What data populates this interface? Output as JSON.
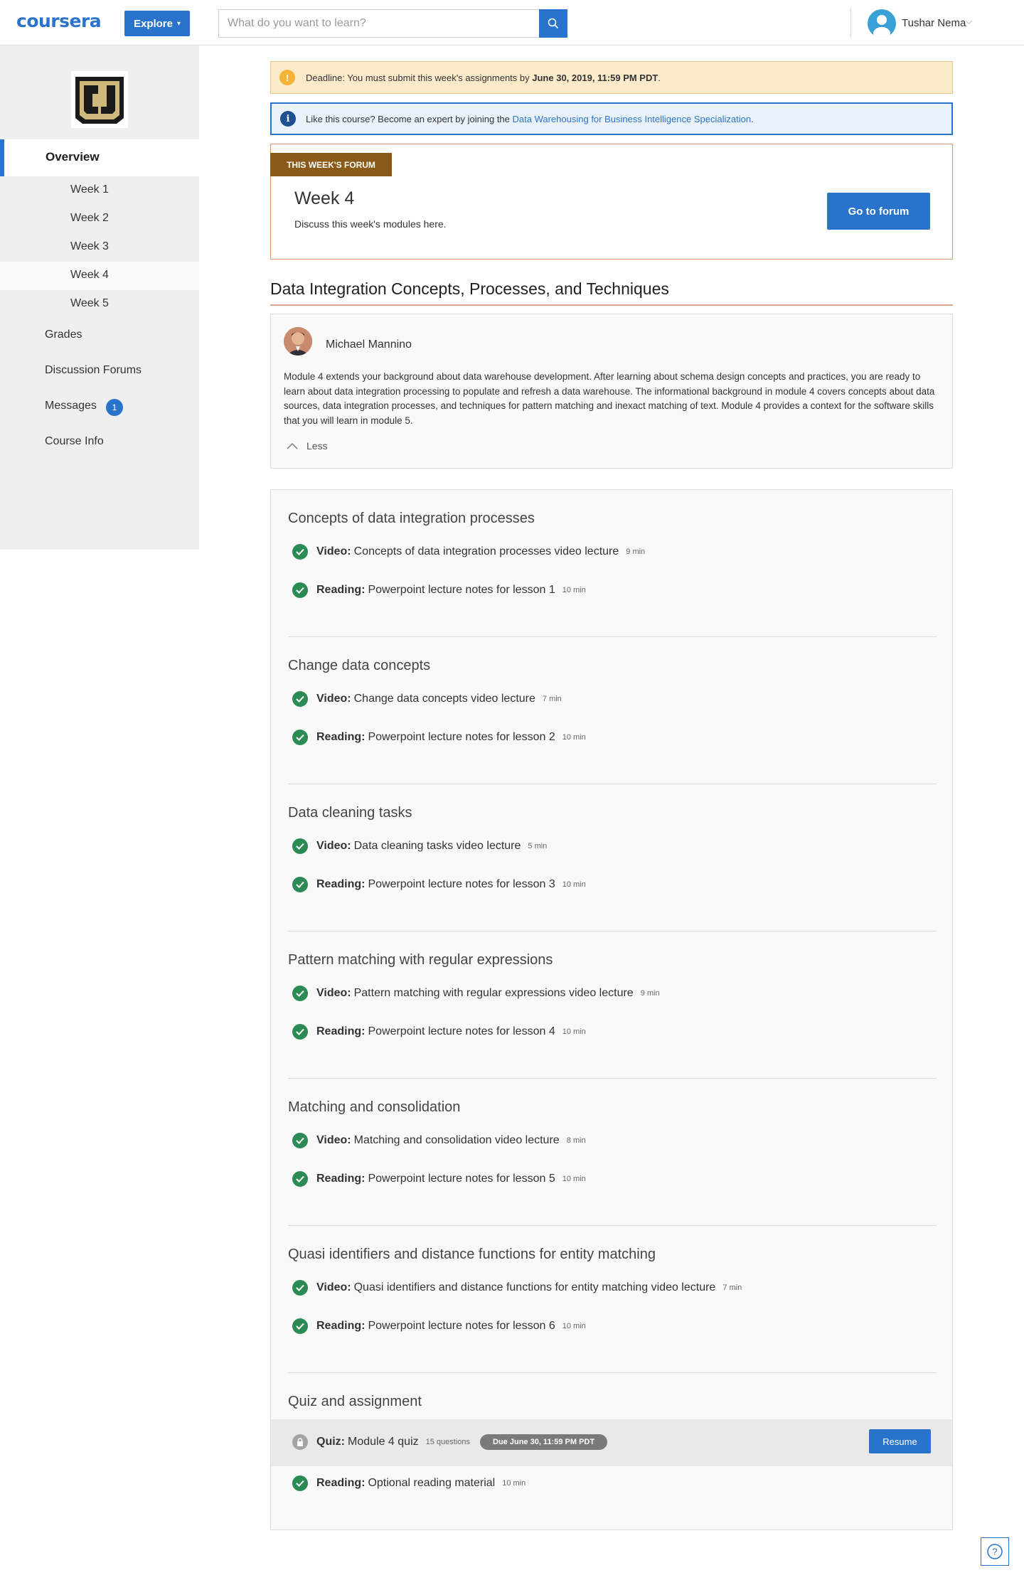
{
  "header": {
    "logo": "coursera",
    "explore_label": "Explore",
    "search_placeholder": "What do you want to learn?",
    "user_name": "Tushar Nema"
  },
  "sidebar": {
    "overview": "Overview",
    "weeks": [
      "Week 1",
      "Week 2",
      "Week 3",
      "Week 4",
      "Week 5"
    ],
    "grades": "Grades",
    "forums": "Discussion Forums",
    "messages": "Messages",
    "messages_count": "1",
    "course_info": "Course Info"
  },
  "deadline": {
    "prefix": "Deadline: You must submit this week's assignments by ",
    "date": "June 30, 2019, 11:59 PM PDT",
    "suffix": "."
  },
  "info": {
    "prefix": "Like this course? Become an expert by joining the ",
    "link": "Data Warehousing for Business Intelligence Specialization",
    "suffix": "."
  },
  "forum": {
    "tag": "THIS WEEK'S FORUM",
    "title": "Week 4",
    "subtitle": "Discuss this week's modules here.",
    "button": "Go to forum"
  },
  "module": {
    "title": "Data Integration Concepts, Processes, and Techniques",
    "instructor": "Michael Mannino",
    "description": "Module 4 extends your background about data warehouse development. After learning about schema design concepts and practices, you are ready to learn about data integration processing to populate and refresh a data warehouse. The informational background in module 4 covers concepts about data sources, data integration processes, and techniques for pattern matching and inexact matching of text. Module 4 provides a context for the software skills that you will learn in module 5.",
    "less_label": "Less"
  },
  "lessons": [
    {
      "title": "Concepts of data integration processes",
      "items": [
        {
          "type": "Video:",
          "name": "Concepts of data integration processes video lecture",
          "duration": "9 min"
        },
        {
          "type": "Reading:",
          "name": "Powerpoint lecture notes for lesson 1",
          "duration": "10 min"
        }
      ]
    },
    {
      "title": "Change data concepts",
      "items": [
        {
          "type": "Video:",
          "name": "Change data concepts video lecture",
          "duration": "7 min"
        },
        {
          "type": "Reading:",
          "name": "Powerpoint lecture notes for lesson 2",
          "duration": "10 min"
        }
      ]
    },
    {
      "title": "Data cleaning tasks",
      "items": [
        {
          "type": "Video:",
          "name": "Data cleaning tasks video lecture",
          "duration": "5 min"
        },
        {
          "type": "Reading:",
          "name": "Powerpoint lecture notes for lesson 3",
          "duration": "10 min"
        }
      ]
    },
    {
      "title": "Pattern matching with regular expressions",
      "items": [
        {
          "type": "Video:",
          "name": "Pattern matching with regular expressions video lecture",
          "duration": "9 min"
        },
        {
          "type": "Reading:",
          "name": "Powerpoint lecture notes for lesson 4",
          "duration": "10 min"
        }
      ]
    },
    {
      "title": "Matching and consolidation",
      "items": [
        {
          "type": "Video:",
          "name": "Matching and consolidation video lecture",
          "duration": "8 min"
        },
        {
          "type": "Reading:",
          "name": "Powerpoint lecture notes for lesson 5",
          "duration": "10 min"
        }
      ]
    },
    {
      "title": "Quasi identifiers and distance functions for entity matching",
      "items": [
        {
          "type": "Video:",
          "name": "Quasi identifiers and distance functions for entity matching video lecture",
          "duration": "7 min"
        },
        {
          "type": "Reading:",
          "name": "Powerpoint lecture notes for lesson 6",
          "duration": "10 min"
        }
      ]
    },
    {
      "title": "Quiz and assignment",
      "quiz": {
        "type": "Quiz:",
        "name": "Module 4 quiz",
        "count": "15 questions",
        "due": "Due June 30, 11:59 PM PDT",
        "button": "Resume"
      },
      "items": [
        {
          "type": "Reading:",
          "name": "Optional reading material",
          "duration": "10 min"
        }
      ]
    }
  ],
  "colors": {
    "brand": "#2a73cc",
    "check": "#2c8a55",
    "forum_tag": "#8a5a18",
    "deadline_bg": "#fceacb"
  },
  "icons": [
    "search-icon",
    "chevron-down-icon",
    "user-icon",
    "warning-icon",
    "info-icon",
    "check-circle-icon",
    "lock-icon",
    "chevron-up-icon",
    "help-icon"
  ]
}
